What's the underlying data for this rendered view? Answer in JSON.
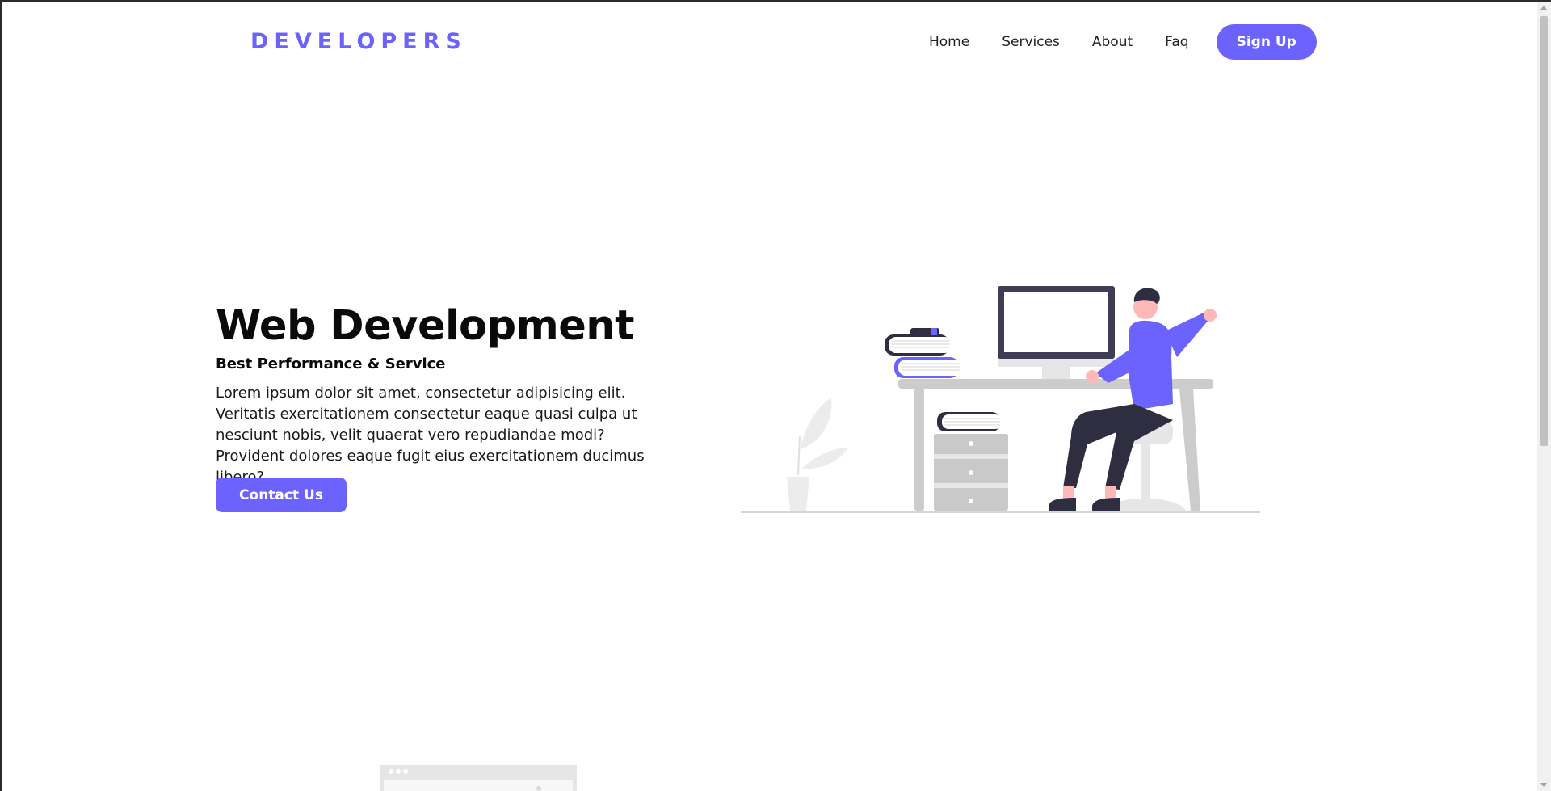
{
  "brand": {
    "logo": "DEVELOPERS",
    "accent_color": "#6c63ff"
  },
  "nav": {
    "items": [
      {
        "label": "Home"
      },
      {
        "label": "Services"
      },
      {
        "label": "About"
      },
      {
        "label": "Faq"
      }
    ],
    "signup_label": "Sign Up"
  },
  "hero": {
    "title": "Web Development",
    "subtitle": "Best Performance & Service",
    "body": "Lorem ipsum dolor sit amet, consectetur adipisicing elit. Veritatis exercitationem consectetur eaque quasi culpa ut nesciunt nobis, velit quaerat vero repudiandae modi? Provident dolores eaque fugit eius exercitationem ducimus libero?",
    "cta_label": "Contact Us",
    "illustration": "developer-at-desk-illustration"
  },
  "colors": {
    "primary": "#6c63ff",
    "dark": "#2f2e41",
    "skin": "#ffb8b8",
    "furniture": "#cccccc",
    "light": "#e6e6e6"
  }
}
